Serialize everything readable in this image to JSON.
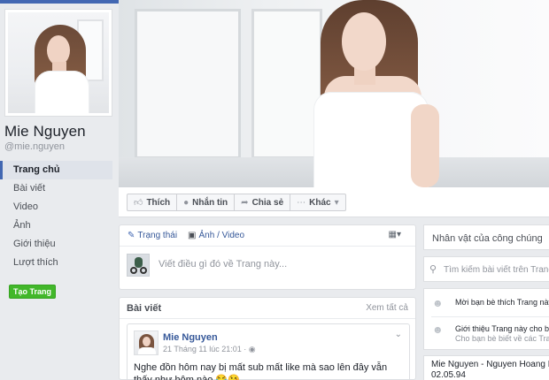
{
  "profile": {
    "name": "Mie Nguyen",
    "handle": "@mie.nguyen"
  },
  "sidebar": {
    "items": [
      {
        "label": "Trang chủ",
        "active": true
      },
      {
        "label": "Bài viết"
      },
      {
        "label": "Video"
      },
      {
        "label": "Ảnh"
      },
      {
        "label": "Giới thiệu"
      },
      {
        "label": "Lượt thích"
      }
    ],
    "create_page_label": "Tạo Trang"
  },
  "actions": {
    "like": "Thích",
    "message": "Nhắn tin",
    "share": "Chia sẻ",
    "more": "Khác"
  },
  "composer": {
    "status_tab": "Trạng thái",
    "photo_video_tab": "Ảnh / Video",
    "placeholder": "Viết điều gì đó về Trang này..."
  },
  "posts": {
    "title": "Bài viết",
    "see_all": "Xem tất cả",
    "items": [
      {
        "author": "Mie Nguyen",
        "timestamp": "21 Tháng 11 lúc 21:01",
        "text": "Nghe đồn hôm nay bị mất sub mất like mà sao lên đây vẫn thấy như hôm nào 😂😘"
      }
    ]
  },
  "right_column": {
    "category": "Nhân vật của công chúng",
    "search_placeholder": "Tìm kiếm bài viết trên Trang",
    "invite_friends_like": "Mời bạn bè thích Trang này",
    "suggest_page": "Giới thiệu Trang này cho bạn bè",
    "suggest_page_sub": "Cho bạn bè biết về các Trang",
    "about_line1": "Mie Nguyen - Nguyen Hoang My",
    "about_line2": "02.05.94"
  },
  "colors": {
    "brand": "#4267b2",
    "link": "#365899",
    "create_button": "#42b72a",
    "background": "#e9ebee"
  }
}
